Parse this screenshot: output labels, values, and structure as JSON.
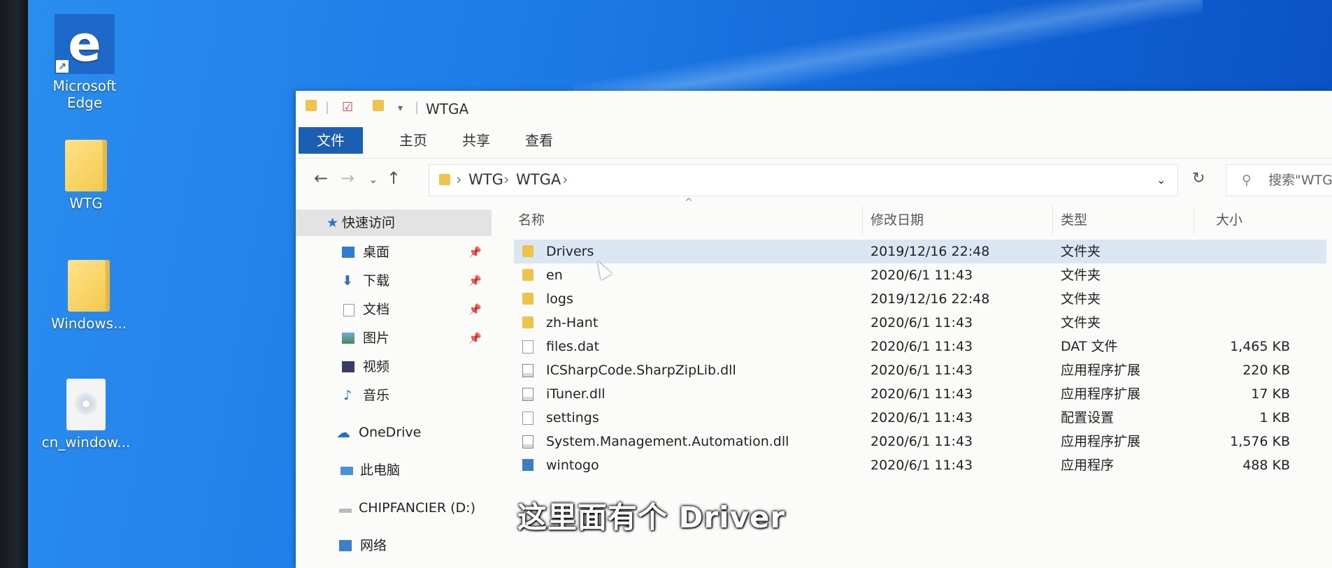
{
  "desktop": {
    "icons": [
      {
        "label_line1": "Microsoft",
        "label_line2": "Edge",
        "icon": "edge-icon"
      },
      {
        "label": "WTG",
        "icon": "folder-icon"
      },
      {
        "label": "Windows...",
        "icon": "folder-icon"
      },
      {
        "label": "cn_window...",
        "icon": "disc-image-icon"
      }
    ]
  },
  "window": {
    "title": "WTGA",
    "ribbon_tabs": [
      "文件",
      "主页",
      "共享",
      "查看"
    ],
    "address": {
      "crumbs": [
        "WTG",
        "WTGA"
      ]
    },
    "search_placeholder": "搜索\"WTG",
    "nav_pane": {
      "quick_access": "快速访问",
      "pinned": [
        "桌面",
        "下载",
        "文档",
        "图片"
      ],
      "others": [
        "视频",
        "音乐"
      ],
      "onedrive": "OneDrive",
      "this_pc": "此电脑",
      "drive": "CHIPFANCIER (D:)",
      "network": "网络"
    },
    "columns": {
      "name": "名称",
      "modified": "修改日期",
      "type": "类型",
      "size": "大小"
    },
    "files": [
      {
        "name": "Drivers",
        "modified": "2019/12/16 22:48",
        "type": "文件夹",
        "size": "",
        "icon": "folder"
      },
      {
        "name": "en",
        "modified": "2020/6/1 11:43",
        "type": "文件夹",
        "size": "",
        "icon": "folder"
      },
      {
        "name": "logs",
        "modified": "2019/12/16 22:48",
        "type": "文件夹",
        "size": "",
        "icon": "folder"
      },
      {
        "name": "zh-Hant",
        "modified": "2020/6/1 11:43",
        "type": "文件夹",
        "size": "",
        "icon": "folder"
      },
      {
        "name": "files.dat",
        "modified": "2020/6/1 11:43",
        "type": "DAT 文件",
        "size": "1,465 KB",
        "icon": "file"
      },
      {
        "name": "ICSharpCode.SharpZipLib.dll",
        "modified": "2020/6/1 11:43",
        "type": "应用程序扩展",
        "size": "220 KB",
        "icon": "dll"
      },
      {
        "name": "iTuner.dll",
        "modified": "2020/6/1 11:43",
        "type": "应用程序扩展",
        "size": "17 KB",
        "icon": "dll"
      },
      {
        "name": "settings",
        "modified": "2020/6/1 11:43",
        "type": "配置设置",
        "size": "1 KB",
        "icon": "file"
      },
      {
        "name": "System.Management.Automation.dll",
        "modified": "2020/6/1 11:43",
        "type": "应用程序扩展",
        "size": "1,576 KB",
        "icon": "dll"
      },
      {
        "name": "wintogo",
        "modified": "2020/6/1 11:43",
        "type": "应用程序",
        "size": "488 KB",
        "icon": "app"
      }
    ]
  },
  "subtitle": "这里面有个 Driver"
}
